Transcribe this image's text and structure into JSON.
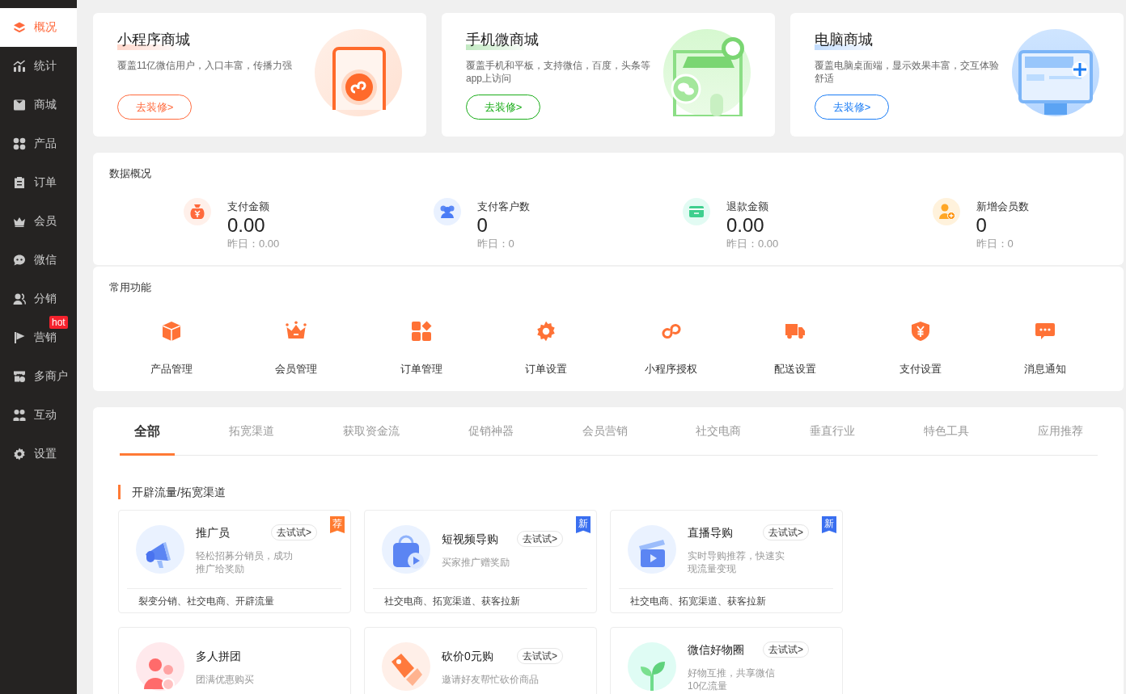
{
  "sidebar": {
    "items": [
      {
        "label": "概况",
        "selected": true
      },
      {
        "label": "统计",
        "selected": false
      },
      {
        "label": "商城",
        "selected": false
      },
      {
        "label": "产品",
        "selected": false
      },
      {
        "label": "订单",
        "selected": false
      },
      {
        "label": "会员",
        "selected": false
      },
      {
        "label": "微信",
        "selected": false
      },
      {
        "label": "分销",
        "selected": false
      },
      {
        "label": "营销",
        "selected": false,
        "badge": "hot"
      },
      {
        "label": "多商户",
        "selected": false
      },
      {
        "label": "互动",
        "selected": false
      },
      {
        "label": "设置",
        "selected": false
      }
    ]
  },
  "stores": [
    {
      "title": "小程序商城",
      "description": "覆盖11亿微信用户，入口丰富，传播力强",
      "button": "去装修>",
      "color": "#ff6a3d"
    },
    {
      "title": "手机微商城",
      "description": "覆盖手机和平板，支持微信，百度，头条等app上访问",
      "button": "去装修>",
      "color": "#1aad19"
    },
    {
      "title": "电脑商城",
      "description": "覆盖电脑桌面端，显示效果丰富，交互体验舒适",
      "button": "去装修>",
      "color": "#1a7cf5"
    }
  ],
  "data_overview": {
    "title": "数据概况",
    "stats": [
      {
        "label": "支付金额",
        "value": "0.00",
        "yesterday": "昨日：0.00"
      },
      {
        "label": "支付客户数",
        "value": "0",
        "yesterday": "昨日：0"
      },
      {
        "label": "退款金额",
        "value": "0.00",
        "yesterday": "昨日：0.00"
      },
      {
        "label": "新增会员数",
        "value": "0",
        "yesterday": "昨日：0"
      }
    ]
  },
  "common_functions": {
    "title": "常用功能",
    "items": [
      "产品管理",
      "会员管理",
      "订单管理",
      "订单设置",
      "小程序授权",
      "配送设置",
      "支付设置",
      "消息通知"
    ]
  },
  "apps": {
    "tabs": [
      {
        "label": "全部",
        "selected": true
      },
      {
        "label": "拓宽渠道",
        "selected": false
      },
      {
        "label": "获取资金流",
        "selected": false
      },
      {
        "label": "促销神器",
        "selected": false
      },
      {
        "label": "会员营销",
        "selected": false
      },
      {
        "label": "社交电商",
        "selected": false
      },
      {
        "label": "垂直行业",
        "selected": false
      },
      {
        "label": "特色工具",
        "selected": false
      },
      {
        "label": "应用推荐",
        "selected": false
      }
    ],
    "section_title": "开辟流量/拓宽渠道",
    "cards": [
      {
        "name": "推广员",
        "try": "去试试>",
        "description": "轻松招募分销员，成功推广给奖励",
        "tags": "裂变分销、社交电商、开辟流量",
        "badge": {
          "text": "荐",
          "color": "#ff7a2f"
        }
      },
      {
        "name": "短视频导购",
        "try": "去试试>",
        "description": "买家推广赠奖励",
        "tags": "社交电商、拓宽渠道、获客拉新",
        "badge": {
          "text": "新",
          "color": "#3a6ff0"
        }
      },
      {
        "name": "直播导购",
        "try": "去试试>",
        "description": "实时导购推荐，快速实现流量变现",
        "tags": "社交电商、拓宽渠道、获客拉新",
        "badge": {
          "text": "新",
          "color": "#3a6ff0"
        }
      },
      {
        "name": "多人拼团",
        "description": "团满优惠购买"
      },
      {
        "name": "砍价0元购",
        "try": "去试试>",
        "description": "邀请好友帮忙砍价商品"
      },
      {
        "name": "微信好物圈",
        "try": "去试试>",
        "description": "好物互推，共享微信10亿流量"
      }
    ]
  }
}
